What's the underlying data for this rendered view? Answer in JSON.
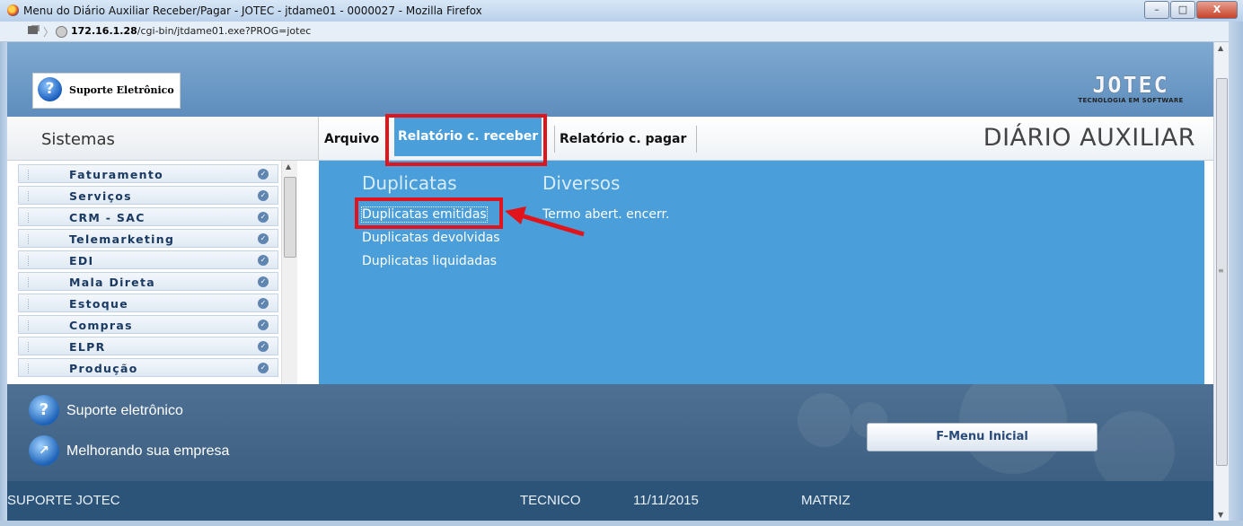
{
  "window": {
    "title": "Menu do Diário Auxiliar Receber/Pagar - JOTEC - jtdame01 - 0000027 - Mozilla Firefox",
    "controls": [
      "–",
      "□",
      "X"
    ]
  },
  "browser": {
    "url_host": "172.16.1.28",
    "url_path": "/cgi-bin/jtdame01.exe?PROG=jotec"
  },
  "header": {
    "suporte_label": "Suporte Eletrônico",
    "logo_text": "JOTEC",
    "logo_tagline": "TECNOLOGIA EM SOFTWARE"
  },
  "nav": {
    "sistemas_label": "Sistemas",
    "menu_arquivo": "Arquivo",
    "menu_relatorio_receber": "Relatório c. receber",
    "menu_relatorio_pagar": "Relatório c. pagar",
    "page_heading": "DIÁRIO AUXILIAR"
  },
  "sidebar": {
    "items": [
      {
        "label": "Faturamento"
      },
      {
        "label": "Serviços"
      },
      {
        "label": "CRM - SAC"
      },
      {
        "label": "Telemarketing"
      },
      {
        "label": "EDI"
      },
      {
        "label": "Mala Direta"
      },
      {
        "label": "Estoque"
      },
      {
        "label": "Compras"
      },
      {
        "label": "ELPR"
      },
      {
        "label": "Produção"
      }
    ]
  },
  "main": {
    "groups": [
      {
        "title": "Duplicatas",
        "links": [
          "Duplicatas emitidas",
          "Duplicatas devolvidas",
          "Duplicatas liquidadas"
        ]
      },
      {
        "title": "Diversos",
        "links": [
          "Termo abert. encerr."
        ]
      }
    ],
    "highlight_color": "#e0141a"
  },
  "footer": {
    "line1": "Suporte eletrônico",
    "line2": "Melhorando sua empresa",
    "menu_button": "F-Menu Inicial"
  },
  "status": {
    "company": "SUPORTE JOTEC",
    "user": "TECNICO",
    "date": "11/11/2015",
    "branch": "MATRIZ"
  },
  "colors": {
    "panel_blue": "#4a9ed9",
    "status_bar": "#2c5479",
    "sidebar_text": "#1b3a62"
  }
}
